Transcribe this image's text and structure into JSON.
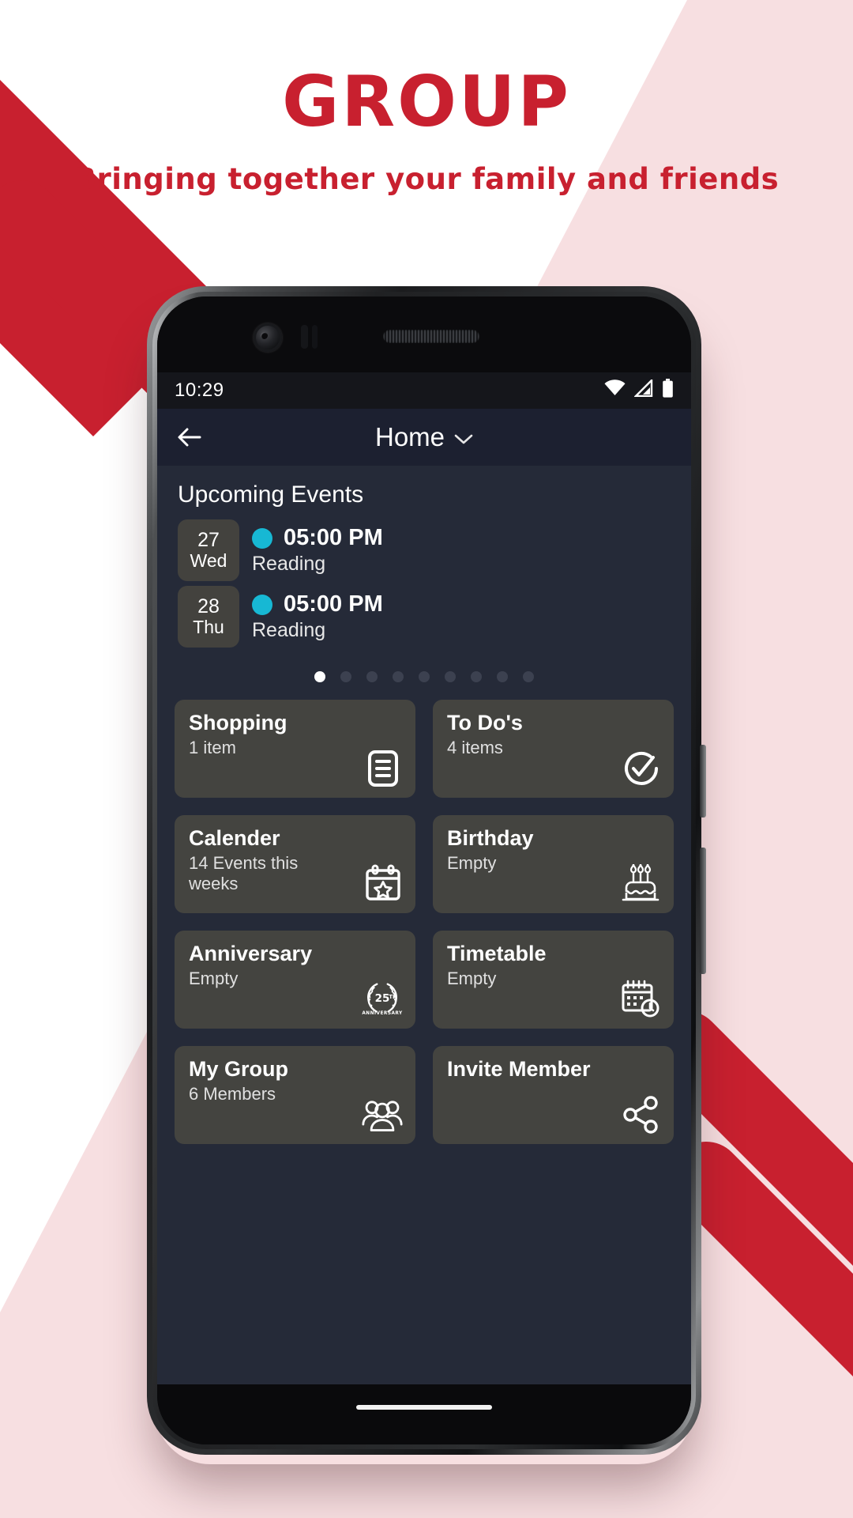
{
  "promo": {
    "title": "GROUP",
    "subtitle": "Bringing together your family and friends",
    "brand_color": "#c8202f",
    "bg_tint_color": "#f7dfe1"
  },
  "status_bar": {
    "time": "10:29",
    "icons": [
      "wifi-icon",
      "signal-icon",
      "battery-icon"
    ]
  },
  "appbar": {
    "back_icon": "back-arrow-icon",
    "title": "Home",
    "dropdown_icon": "chevron-down-icon"
  },
  "events_section": {
    "heading": "Upcoming Events",
    "accent_color": "#17b8d4",
    "events": [
      {
        "day": "27",
        "weekday": "Wed",
        "time": "05:00 PM",
        "title": "Reading"
      },
      {
        "day": "28",
        "weekday": "Thu",
        "time": "05:00 PM",
        "title": "Reading"
      }
    ],
    "pager": {
      "count": 9,
      "active_index": 0
    }
  },
  "cards": [
    {
      "title": "Shopping",
      "subtitle": "1 item",
      "icon": "list-document-icon"
    },
    {
      "title": "To Do's",
      "subtitle": "4 items",
      "icon": "check-circle-icon"
    },
    {
      "title": "Calender",
      "subtitle": "14 Events this weeks",
      "icon": "calendar-star-icon"
    },
    {
      "title": "Birthday",
      "subtitle": "Empty",
      "icon": "birthday-cake-icon"
    },
    {
      "title": "Anniversary",
      "subtitle": "Empty",
      "icon": "anniversary-wreath-icon"
    },
    {
      "title": "Timetable",
      "subtitle": "Empty",
      "icon": "calendar-clock-icon"
    },
    {
      "title": "My Group",
      "subtitle": "6 Members",
      "icon": "people-group-icon"
    },
    {
      "title": "Invite Member",
      "subtitle": "",
      "icon": "share-icon"
    }
  ],
  "theme": {
    "screen_bg": "#252a38",
    "card_bg": "#444440",
    "appbar_bg": "#1c2030"
  }
}
